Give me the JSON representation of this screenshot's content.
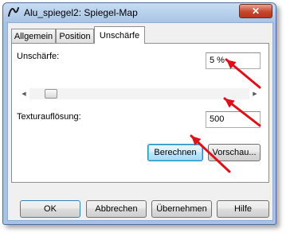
{
  "window": {
    "title": "Alu_spiegel2: Spiegel-Map",
    "close_glyph": "✕"
  },
  "tabs": [
    {
      "label": "Allgemein",
      "active": false
    },
    {
      "label": "Position",
      "active": false
    },
    {
      "label": "Unschärfe",
      "active": true
    }
  ],
  "panel": {
    "blur_label": "Unschärfe:",
    "blur_value": "5 %",
    "blur_slider_fraction": 0.05,
    "texture_label": "Texturauflösung:",
    "texture_value": "500",
    "calculate_button": "Berechnen",
    "preview_button": "Vorschau..."
  },
  "footer": {
    "ok": "OK",
    "cancel": "Abbrechen",
    "apply": "Übernehmen",
    "help": "Hilfe"
  },
  "annotations": {
    "arrow_color": "#e0101a"
  },
  "icons": [
    "app-icon",
    "close-icon",
    "slider-left-arrow-icon",
    "slider-right-arrow-icon"
  ]
}
